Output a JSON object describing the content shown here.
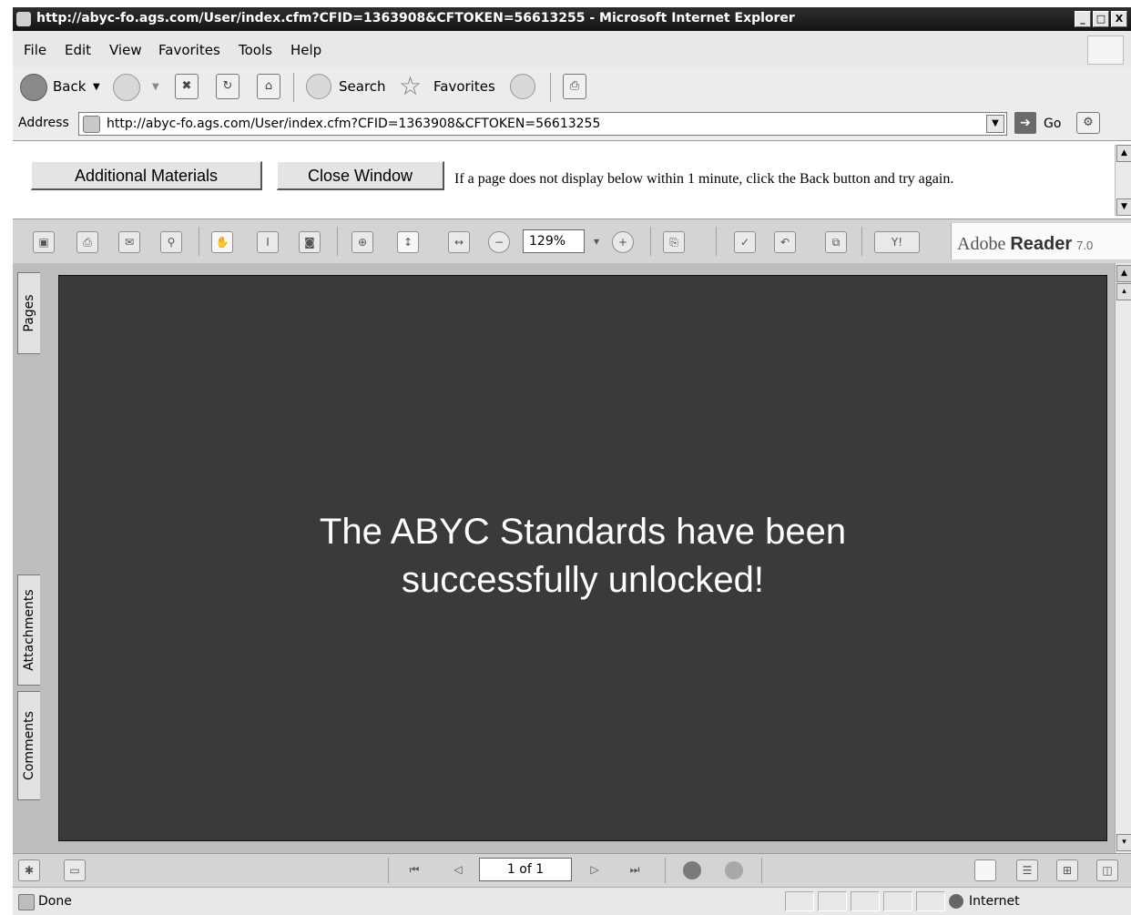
{
  "window": {
    "title": "http://abyc-fo.ags.com/User/index.cfm?CFID=1363908&CFTOKEN=56613255 - Microsoft Internet Explorer",
    "minimize": "_",
    "maximize": "□",
    "close": "X"
  },
  "menu": [
    "File",
    "Edit",
    "View",
    "Favorites",
    "Tools",
    "Help"
  ],
  "navbar": {
    "back_label": "Back",
    "search_label": "Search",
    "favorites_label": "Favorites"
  },
  "address": {
    "label": "Address",
    "url": "http://abyc-fo.ags.com/User/index.cfm?CFID=1363908&CFTOKEN=56613255",
    "go_label": "Go"
  },
  "content": {
    "additional_materials": "Additional Materials",
    "close_window": "Close Window",
    "notice": "If a page does not display below within 1 minute, click the Back button and try again."
  },
  "reader": {
    "zoom": "129%",
    "brand": "Adobe",
    "product": "Reader",
    "version": "7.0",
    "sidetabs": [
      "Pages",
      "Attachments",
      "Comments"
    ],
    "message_line1": "The ABYC Standards have been",
    "message_line2": "successfully unlocked!",
    "page_indicator": "1 of 1"
  },
  "status": {
    "text": "Done",
    "zone": "Internet"
  }
}
